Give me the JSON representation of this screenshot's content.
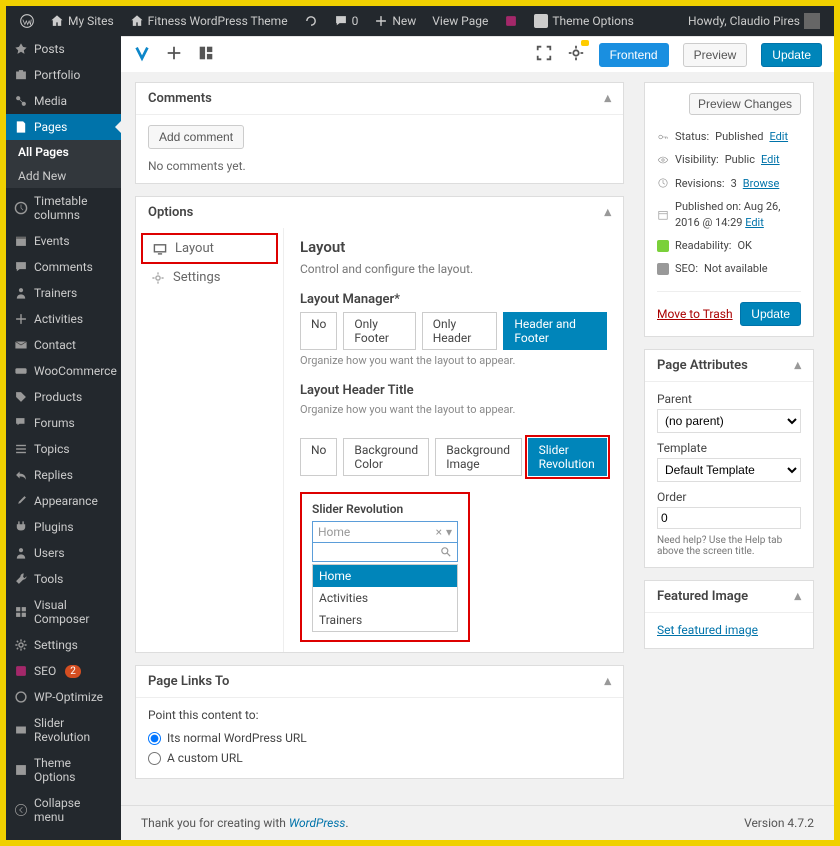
{
  "admin_bar": {
    "my_sites": "My Sites",
    "site_name": "Fitness WordPress Theme",
    "comments": "0",
    "new": "New",
    "view_page": "View Page",
    "theme_options": "Theme Options",
    "howdy": "Howdy, Claudio Pires"
  },
  "sidebar": {
    "items": [
      {
        "label": "Posts"
      },
      {
        "label": "Portfolio"
      },
      {
        "label": "Media"
      },
      {
        "label": "Pages"
      },
      {
        "label": "Timetable columns"
      },
      {
        "label": "Events"
      },
      {
        "label": "Comments"
      },
      {
        "label": "Trainers"
      },
      {
        "label": "Activities"
      },
      {
        "label": "Contact"
      },
      {
        "label": "WooCommerce"
      },
      {
        "label": "Products"
      },
      {
        "label": "Forums"
      },
      {
        "label": "Topics"
      },
      {
        "label": "Replies"
      },
      {
        "label": "Appearance"
      },
      {
        "label": "Plugins"
      },
      {
        "label": "Users"
      },
      {
        "label": "Tools"
      },
      {
        "label": "Visual Composer"
      },
      {
        "label": "Settings"
      },
      {
        "label": "SEO"
      },
      {
        "label": "WP-Optimize"
      },
      {
        "label": "Slider Revolution"
      },
      {
        "label": "Theme Options"
      },
      {
        "label": "Collapse menu"
      }
    ],
    "sub": {
      "all": "All Pages",
      "add": "Add New"
    },
    "seo_badge": "2"
  },
  "vc_toolbar": {
    "frontend": "Frontend",
    "preview": "Preview",
    "update": "Update"
  },
  "comments_box": {
    "title": "Comments",
    "add_btn": "Add comment",
    "no_comments": "No comments yet."
  },
  "options_box": {
    "title": "Options",
    "sidebar": {
      "layout": "Layout",
      "settings": "Settings"
    },
    "heading": "Layout",
    "desc": "Control and configure the layout.",
    "layout_manager": {
      "label": "Layout Manager*",
      "opts": [
        "No",
        "Only Footer",
        "Only Header",
        "Header and Footer"
      ],
      "hint": "Organize how you want the layout to appear."
    },
    "header_title": {
      "label": "Layout Header Title",
      "hint": "Organize how you want the layout to appear.",
      "opts": [
        "No",
        "Background Color",
        "Background Image",
        "Slider Revolution"
      ]
    },
    "slider_rev": {
      "label": "Slider Revolution",
      "selected": "Home",
      "options": [
        "Home",
        "Activities",
        "Trainers"
      ]
    }
  },
  "page_links": {
    "title": "Page Links To",
    "desc": "Point this content to:",
    "r1": "Its normal WordPress URL",
    "r2": "A custom URL"
  },
  "publish_box": {
    "preview": "Preview Changes",
    "status_l": "Status:",
    "status_v": "Published",
    "edit": "Edit",
    "vis_l": "Visibility:",
    "vis_v": "Public",
    "rev_l": "Revisions:",
    "rev_v": "3",
    "browse": "Browse",
    "pub_l": "Published on:",
    "pub_v": "Aug 26, 2016 @ 14:29",
    "read_l": "Readability:",
    "read_v": "OK",
    "seo_l": "SEO:",
    "seo_v": "Not available",
    "trash": "Move to Trash",
    "update": "Update"
  },
  "page_attr": {
    "title": "Page Attributes",
    "parent_l": "Parent",
    "parent_v": "(no parent)",
    "template_l": "Template",
    "template_v": "Default Template",
    "order_l": "Order",
    "order_v": "0",
    "hint": "Need help? Use the Help tab above the screen title."
  },
  "featured_image": {
    "title": "Featured Image",
    "link": "Set featured image"
  },
  "footer": {
    "thanks": "Thank you for creating with ",
    "wp": "WordPress",
    "version": "Version 4.7.2"
  }
}
